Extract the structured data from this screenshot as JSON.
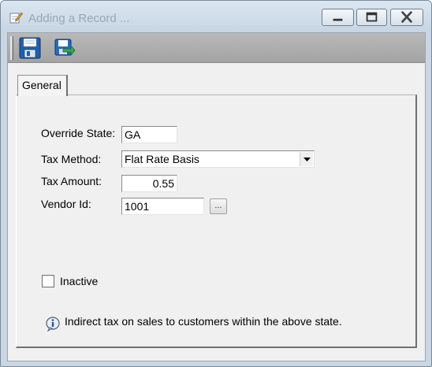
{
  "window": {
    "title": "Adding a Record ...",
    "icons": {
      "title": "edit-record-icon",
      "minimize": "minimize-icon",
      "maximize": "maximize-icon",
      "close": "close-icon"
    }
  },
  "toolbar": {
    "buttons": [
      {
        "name": "save",
        "icon": "floppy-disk-icon"
      },
      {
        "name": "save-and-close",
        "icon": "save-close-icon"
      }
    ]
  },
  "tabs": [
    {
      "label": "General",
      "active": true
    }
  ],
  "form": {
    "override_state": {
      "label": "Override State:",
      "value": "GA"
    },
    "tax_method": {
      "label": "Tax Method:",
      "value": "Flat Rate Basis"
    },
    "tax_amount": {
      "label": "Tax Amount:",
      "value": "0.55"
    },
    "vendor_id": {
      "label": "Vendor Id:",
      "value": "1001",
      "lookup_label": "..."
    },
    "inactive": {
      "label": "Inactive",
      "checked": false
    }
  },
  "info": {
    "icon": "info-icon",
    "text": "Indirect tax on sales to customers within the above state."
  },
  "colors": {
    "titlebar": "#c9d6e3",
    "toolbar": "#a8a8a8",
    "panel": "#f0f0f0",
    "close_x": "#444444"
  }
}
